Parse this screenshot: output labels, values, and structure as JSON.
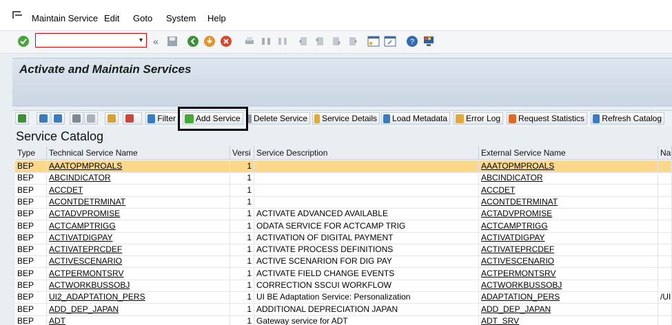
{
  "menu": {
    "items": [
      "Maintain Service",
      "Edit",
      "Goto",
      "System",
      "Help"
    ]
  },
  "toolbar": {
    "command_value": "",
    "icons": [
      "check-icon",
      "back-double-icon",
      "save-icon",
      "back-icon",
      "exit-icon",
      "cancel-icon",
      "print-icon",
      "find-icon",
      "find-next-icon",
      "first-page-icon",
      "previous-page-icon",
      "next-page-icon",
      "last-page-icon",
      "new-session-icon",
      "shortcut-icon",
      "help-icon",
      "layout-icon"
    ]
  },
  "page": {
    "title": "Activate and Maintain Services"
  },
  "alv": {
    "buttons": {
      "filter": "Filter",
      "add_service": "Add Service",
      "delete_service": "Delete Service",
      "service_details": "Service Details",
      "load_metadata": "Load Metadata",
      "error_log": "Error Log",
      "request_statistics": "Request Statistics",
      "refresh_catalog": "Refresh Catalog"
    }
  },
  "catalog": {
    "heading": "Service Catalog",
    "columns": [
      "Type",
      "Technical Service Name",
      "Versi",
      "Service Description",
      "External Service Name",
      "Nar"
    ],
    "rows": [
      [
        "BEP",
        "AAATOPMPROALS",
        "1",
        "",
        "AAATOPMPROALS",
        ""
      ],
      [
        "BEP",
        "ABCINDICATOR",
        "1",
        "",
        "ABCINDICATOR",
        ""
      ],
      [
        "BEP",
        "ACCDET",
        "1",
        "",
        "ACCDET",
        ""
      ],
      [
        "BEP",
        "ACONTDETRMINAT",
        "1",
        "",
        "ACONTDETRMINAT",
        ""
      ],
      [
        "BEP",
        "ACTADVPROMISE",
        "1",
        "ACTIVATE ADVANCED AVAILABLE",
        "ACTADVPROMISE",
        ""
      ],
      [
        "BEP",
        "ACTCAMPTRIGG",
        "1",
        "ODATA SERVICE FOR ACTCAMP TRIG",
        "ACTCAMPTRIGG",
        ""
      ],
      [
        "BEP",
        "ACTIVATDIGPAY",
        "1",
        "ACTIVATION OF DIGITAL PAYMENT",
        "ACTIVATDIGPAY",
        ""
      ],
      [
        "BEP",
        "ACTIVATEPRCDEF",
        "1",
        "ACTIVATE PROCESS DEFINITIONS",
        "ACTIVATEPRCDEF",
        ""
      ],
      [
        "BEP",
        "ACTIVESCENARIO",
        "1",
        "ACTIVE SCENARION FOR DIG PAY",
        "ACTIVESCENARIO",
        ""
      ],
      [
        "BEP",
        "ACTPERMONTSRV",
        "1",
        "ACTIVATE FIELD CHANGE EVENTS",
        "ACTPERMONTSRV",
        ""
      ],
      [
        "BEP",
        "ACTWORKBUSSOBJ",
        "1",
        "CORRECTION SSCUI WORKFLOW",
        "ACTWORKBUSSOBJ",
        ""
      ],
      [
        "BEP",
        "UI2_ADAPTATION_PERS",
        "1",
        "UI BE Adaptation Service: Personalization",
        "ADAPTATION_PERS",
        "/UI"
      ],
      [
        "BEP",
        "ADD_DEP_JAPAN",
        "1",
        "ADDITIONAL DEPRECIATION JAPAN",
        "ADD_DEP_JAPAN",
        ""
      ],
      [
        "BEP",
        "ADT",
        "1",
        "Gateway service for ADT",
        "ADT_SRV",
        ""
      ]
    ]
  },
  "colors": {
    "selected_row": "#fbd88a",
    "title_bg": "#d3dde7",
    "accent_red": "#dd0000"
  }
}
